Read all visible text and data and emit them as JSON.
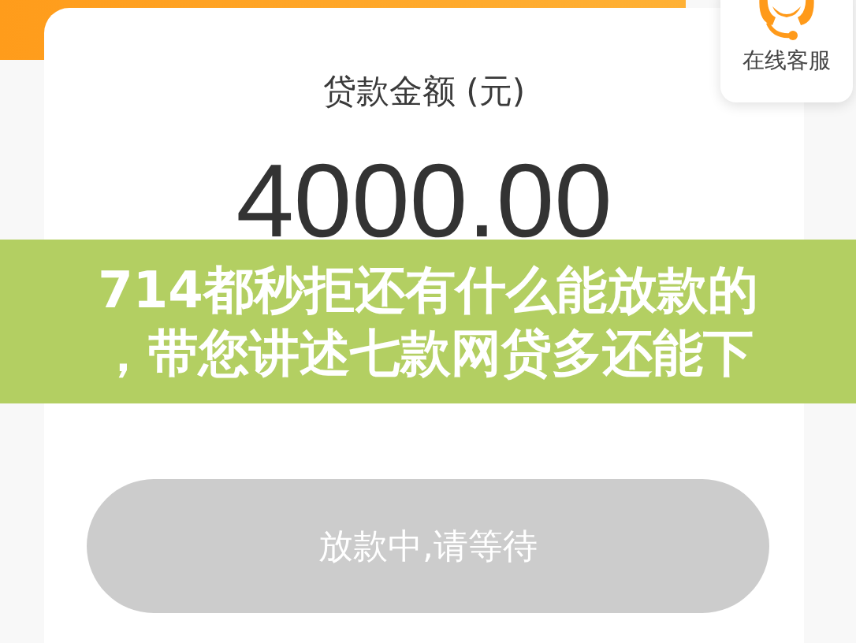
{
  "service_widget": {
    "label": "在线客服"
  },
  "loan": {
    "label": "贷款金额 (元)",
    "amount": "4000.00",
    "button": {
      "label": "放款中,请等待",
      "disabled": true
    }
  },
  "banner": {
    "lines": [
      "714都秒拒还有什么能放款的",
      "，带您讲述七款网贷多还能下"
    ]
  }
}
